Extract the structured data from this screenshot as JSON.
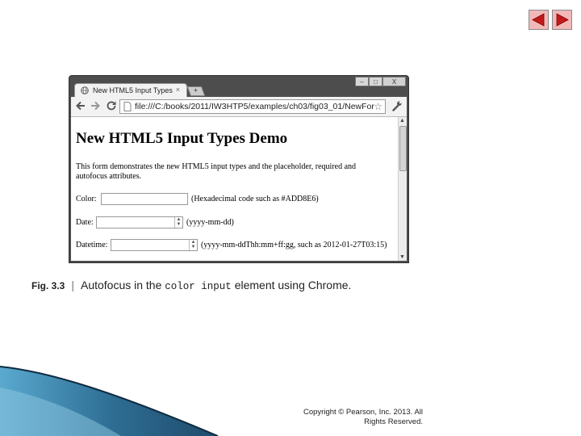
{
  "browser": {
    "tab_title": "New HTML5 Input Types",
    "tab_close": "×",
    "new_tab": "+",
    "window_buttons": {
      "minimize": "–",
      "maximize": "□",
      "close": "X"
    },
    "url": "file:///C:/books/2011/IW3HTP5/examples/ch03/fig03_01/NewFor"
  },
  "page": {
    "title": "New HTML5 Input Types Demo",
    "description": "This form demonstrates the new HTML5 input types and the placeholder, required and autofocus attributes.",
    "fields": [
      {
        "label": "Color:",
        "hint": "(Hexadecimal code such as #ADD8E6)"
      },
      {
        "label": "Date:",
        "hint": "(yyyy-mm-dd)"
      },
      {
        "label": "Datetime:",
        "hint": "(yyyy-mm-ddThh:mm+ff:gg, such as 2012-01-27T03:15)"
      }
    ]
  },
  "caption": {
    "fig": "Fig. 3.3",
    "sep": "|",
    "text_before": "Autofocus in the",
    "code": "color input",
    "text_after": "element using Chrome."
  },
  "copyright": {
    "line1": "Copyright © Pearson, Inc. 2013. All",
    "line2": "Rights Reserved."
  },
  "icons": {
    "prev": "left-arrow-icon",
    "next": "right-arrow-icon",
    "back": "back-arrow-icon",
    "forward": "forward-arrow-icon",
    "reload": "reload-icon",
    "star": "star-icon",
    "wrench": "wrench-icon"
  },
  "colors": {
    "nav_button": "#f2b8b8",
    "nav_arrow": "#c21a1a",
    "window_frame": "#4d4d4d",
    "swoosh_dark": "#1e4a6b",
    "swoosh_light": "#5aa9cf"
  }
}
